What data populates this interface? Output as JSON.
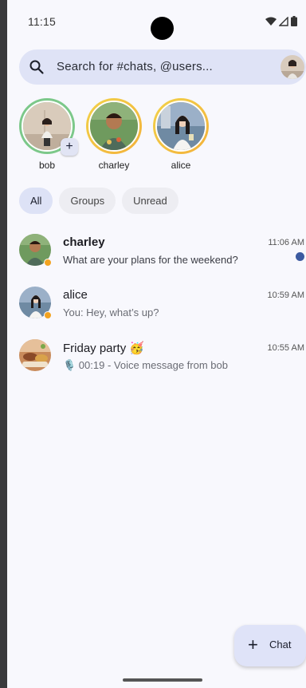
{
  "status_bar": {
    "time": "11:15"
  },
  "search": {
    "placeholder": "Search for #chats, @users..."
  },
  "stories": [
    {
      "name": "bob",
      "add_badge": "+"
    },
    {
      "name": "charley"
    },
    {
      "name": "alice"
    }
  ],
  "filters": [
    {
      "label": "All",
      "active": true
    },
    {
      "label": "Groups"
    },
    {
      "label": "Unread"
    }
  ],
  "chats": [
    {
      "title": "charley",
      "preview": "What are your plans for the weekend?",
      "time": "11:06 AM",
      "unread": true
    },
    {
      "title": "alice",
      "preview": "You: Hey, what’s up?",
      "time": "10:59 AM"
    },
    {
      "title": "Friday party 🥳",
      "preview": "🎙️ 00:19 - Voice message from bob",
      "time": "10:55 AM"
    }
  ],
  "fab": {
    "icon": "+",
    "label": "Chat"
  },
  "colors": {
    "accent": "#dfe3f6",
    "presence": "#f2a321",
    "unread": "#3c5aa0",
    "story_green": "#7cc88a",
    "story_gold": "#f3b13a"
  }
}
